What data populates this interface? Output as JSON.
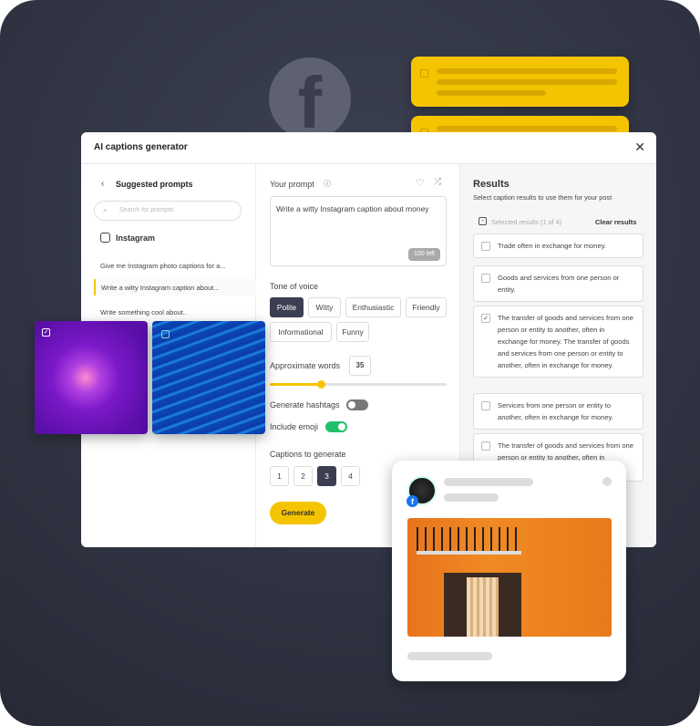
{
  "dialog": {
    "title": "AI captions generator",
    "close_icon": "close-icon"
  },
  "left": {
    "title": "Suggested prompts",
    "search_placeholder": "Search for prompts",
    "category": "Instagram",
    "prompts": [
      "Give me Instagram photo captions for a...",
      "Write a witty Instagram caption about...",
      "Write something cool about.."
    ],
    "active_prompt": 1
  },
  "mid": {
    "prompt_label": "Your prompt",
    "prompt_value": "Write a witty Instagram caption about money",
    "chars_left": "100 left",
    "tone_label": "Tone of voice",
    "tones": [
      "Polite",
      "Witty",
      "Enthusiastic",
      "Friendly",
      "Informational",
      "Funny"
    ],
    "selected_tone": "Polite",
    "words_label": "Approximate words",
    "words_value": "35",
    "words_slider_fraction": 0.29,
    "hashtags_label": "Generate hashtags",
    "hashtags_on": false,
    "emoji_label": "Include emoji",
    "emoji_on": true,
    "captions_label": "Captions to generate",
    "caption_counts": [
      "1",
      "2",
      "3",
      "4"
    ],
    "selected_count": "3",
    "generate_label": "Generate"
  },
  "right": {
    "title": "Results",
    "subtitle": "Select caption results to use them for your post",
    "selected_text": "Selected results (1 of 4)",
    "clear_label": "Clear results",
    "results": [
      {
        "text": "Trade often in exchange for money.",
        "checked": false
      },
      {
        "text": "Goods and services from one person or entity.",
        "checked": false
      },
      {
        "text": "The transfer of goods and services from one person or entity to another, often in exchange for money. The transfer of goods and services from one person or entity to another, often in exchange for money.",
        "checked": true
      },
      {
        "text": "Services from one person or entity to another, often in exchange for money.",
        "checked": false
      },
      {
        "text": "The transfer of goods and services from one person or entity to another, often in exchange for money.",
        "checked": false
      }
    ]
  },
  "colors": {
    "accent": "#f5c400",
    "dark": "#3c3f51",
    "toggle_on": "#22c06b",
    "background": "#2d3140"
  }
}
